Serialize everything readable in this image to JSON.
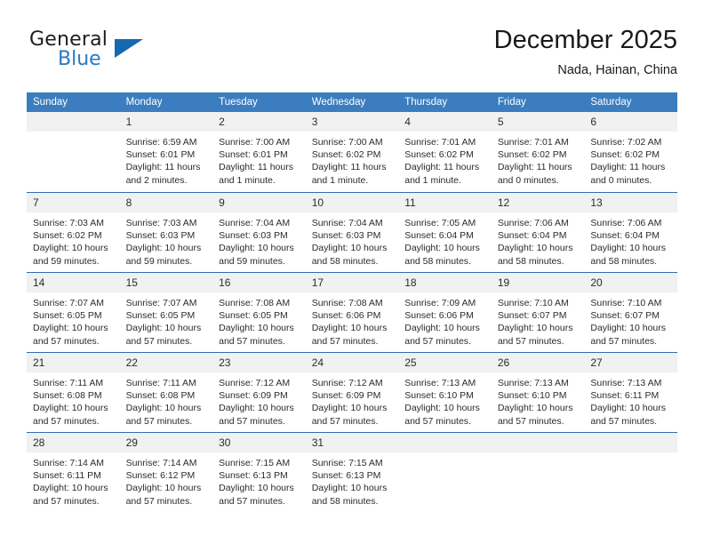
{
  "brand": {
    "name_part1": "General",
    "name_part2": "Blue",
    "triangle_color": "#1668b3"
  },
  "header": {
    "title": "December 2025",
    "location": "Nada, Hainan, China"
  },
  "theme": {
    "header_row_bg": "#3b7dbf",
    "daynum_bg": "#f1f1f1",
    "row_divider": "#2f6fad"
  },
  "weekday_headers": [
    "Sunday",
    "Monday",
    "Tuesday",
    "Wednesday",
    "Thursday",
    "Friday",
    "Saturday"
  ],
  "weeks": [
    [
      {
        "day": "",
        "empty": true
      },
      {
        "day": "1",
        "sunrise": "Sunrise: 6:59 AM",
        "sunset": "Sunset: 6:01 PM",
        "daylight": "Daylight: 11 hours and 2 minutes."
      },
      {
        "day": "2",
        "sunrise": "Sunrise: 7:00 AM",
        "sunset": "Sunset: 6:01 PM",
        "daylight": "Daylight: 11 hours and 1 minute."
      },
      {
        "day": "3",
        "sunrise": "Sunrise: 7:00 AM",
        "sunset": "Sunset: 6:02 PM",
        "daylight": "Daylight: 11 hours and 1 minute."
      },
      {
        "day": "4",
        "sunrise": "Sunrise: 7:01 AM",
        "sunset": "Sunset: 6:02 PM",
        "daylight": "Daylight: 11 hours and 1 minute."
      },
      {
        "day": "5",
        "sunrise": "Sunrise: 7:01 AM",
        "sunset": "Sunset: 6:02 PM",
        "daylight": "Daylight: 11 hours and 0 minutes."
      },
      {
        "day": "6",
        "sunrise": "Sunrise: 7:02 AM",
        "sunset": "Sunset: 6:02 PM",
        "daylight": "Daylight: 11 hours and 0 minutes."
      }
    ],
    [
      {
        "day": "7",
        "sunrise": "Sunrise: 7:03 AM",
        "sunset": "Sunset: 6:02 PM",
        "daylight": "Daylight: 10 hours and 59 minutes."
      },
      {
        "day": "8",
        "sunrise": "Sunrise: 7:03 AM",
        "sunset": "Sunset: 6:03 PM",
        "daylight": "Daylight: 10 hours and 59 minutes."
      },
      {
        "day": "9",
        "sunrise": "Sunrise: 7:04 AM",
        "sunset": "Sunset: 6:03 PM",
        "daylight": "Daylight: 10 hours and 59 minutes."
      },
      {
        "day": "10",
        "sunrise": "Sunrise: 7:04 AM",
        "sunset": "Sunset: 6:03 PM",
        "daylight": "Daylight: 10 hours and 58 minutes."
      },
      {
        "day": "11",
        "sunrise": "Sunrise: 7:05 AM",
        "sunset": "Sunset: 6:04 PM",
        "daylight": "Daylight: 10 hours and 58 minutes."
      },
      {
        "day": "12",
        "sunrise": "Sunrise: 7:06 AM",
        "sunset": "Sunset: 6:04 PM",
        "daylight": "Daylight: 10 hours and 58 minutes."
      },
      {
        "day": "13",
        "sunrise": "Sunrise: 7:06 AM",
        "sunset": "Sunset: 6:04 PM",
        "daylight": "Daylight: 10 hours and 58 minutes."
      }
    ],
    [
      {
        "day": "14",
        "sunrise": "Sunrise: 7:07 AM",
        "sunset": "Sunset: 6:05 PM",
        "daylight": "Daylight: 10 hours and 57 minutes."
      },
      {
        "day": "15",
        "sunrise": "Sunrise: 7:07 AM",
        "sunset": "Sunset: 6:05 PM",
        "daylight": "Daylight: 10 hours and 57 minutes."
      },
      {
        "day": "16",
        "sunrise": "Sunrise: 7:08 AM",
        "sunset": "Sunset: 6:05 PM",
        "daylight": "Daylight: 10 hours and 57 minutes."
      },
      {
        "day": "17",
        "sunrise": "Sunrise: 7:08 AM",
        "sunset": "Sunset: 6:06 PM",
        "daylight": "Daylight: 10 hours and 57 minutes."
      },
      {
        "day": "18",
        "sunrise": "Sunrise: 7:09 AM",
        "sunset": "Sunset: 6:06 PM",
        "daylight": "Daylight: 10 hours and 57 minutes."
      },
      {
        "day": "19",
        "sunrise": "Sunrise: 7:10 AM",
        "sunset": "Sunset: 6:07 PM",
        "daylight": "Daylight: 10 hours and 57 minutes."
      },
      {
        "day": "20",
        "sunrise": "Sunrise: 7:10 AM",
        "sunset": "Sunset: 6:07 PM",
        "daylight": "Daylight: 10 hours and 57 minutes."
      }
    ],
    [
      {
        "day": "21",
        "sunrise": "Sunrise: 7:11 AM",
        "sunset": "Sunset: 6:08 PM",
        "daylight": "Daylight: 10 hours and 57 minutes."
      },
      {
        "day": "22",
        "sunrise": "Sunrise: 7:11 AM",
        "sunset": "Sunset: 6:08 PM",
        "daylight": "Daylight: 10 hours and 57 minutes."
      },
      {
        "day": "23",
        "sunrise": "Sunrise: 7:12 AM",
        "sunset": "Sunset: 6:09 PM",
        "daylight": "Daylight: 10 hours and 57 minutes."
      },
      {
        "day": "24",
        "sunrise": "Sunrise: 7:12 AM",
        "sunset": "Sunset: 6:09 PM",
        "daylight": "Daylight: 10 hours and 57 minutes."
      },
      {
        "day": "25",
        "sunrise": "Sunrise: 7:13 AM",
        "sunset": "Sunset: 6:10 PM",
        "daylight": "Daylight: 10 hours and 57 minutes."
      },
      {
        "day": "26",
        "sunrise": "Sunrise: 7:13 AM",
        "sunset": "Sunset: 6:10 PM",
        "daylight": "Daylight: 10 hours and 57 minutes."
      },
      {
        "day": "27",
        "sunrise": "Sunrise: 7:13 AM",
        "sunset": "Sunset: 6:11 PM",
        "daylight": "Daylight: 10 hours and 57 minutes."
      }
    ],
    [
      {
        "day": "28",
        "sunrise": "Sunrise: 7:14 AM",
        "sunset": "Sunset: 6:11 PM",
        "daylight": "Daylight: 10 hours and 57 minutes."
      },
      {
        "day": "29",
        "sunrise": "Sunrise: 7:14 AM",
        "sunset": "Sunset: 6:12 PM",
        "daylight": "Daylight: 10 hours and 57 minutes."
      },
      {
        "day": "30",
        "sunrise": "Sunrise: 7:15 AM",
        "sunset": "Sunset: 6:13 PM",
        "daylight": "Daylight: 10 hours and 57 minutes."
      },
      {
        "day": "31",
        "sunrise": "Sunrise: 7:15 AM",
        "sunset": "Sunset: 6:13 PM",
        "daylight": "Daylight: 10 hours and 58 minutes."
      },
      {
        "day": "",
        "empty": true
      },
      {
        "day": "",
        "empty": true
      },
      {
        "day": "",
        "empty": true
      }
    ]
  ]
}
